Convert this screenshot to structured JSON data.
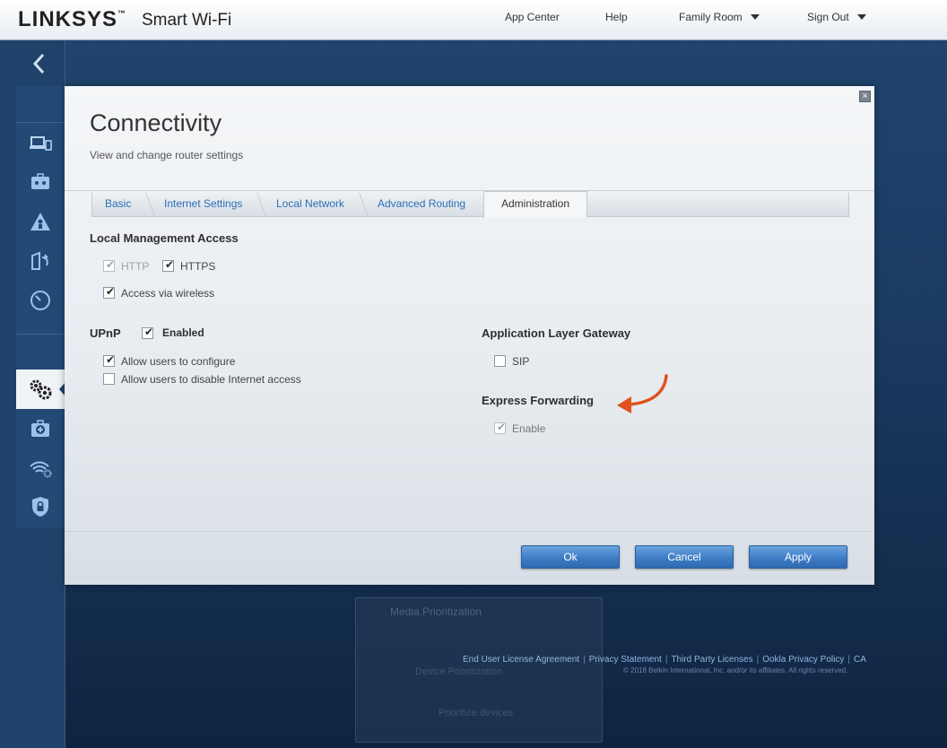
{
  "header": {
    "brand": "LINKSYS",
    "brand_tm": "™",
    "product": "Smart Wi-Fi",
    "nav": {
      "app_center": "App Center",
      "help": "Help",
      "network_name": "Family Room",
      "sign_out": "Sign Out"
    }
  },
  "sidebar": {
    "icons": [
      "devices-icon",
      "parental-controls-icon",
      "guest-access-icon",
      "media-prioritization-icon",
      "speed-test-icon",
      "connectivity-gear-icon",
      "troubleshooting-icon",
      "wireless-icon",
      "security-icon"
    ],
    "active": "connectivity-gear-icon"
  },
  "dialog": {
    "title": "Connectivity",
    "subtitle": "View and change router settings",
    "tabs": [
      "Basic",
      "Internet Settings",
      "Local Network",
      "Advanced Routing",
      "Administration"
    ],
    "active_tab": "Administration",
    "local_management": {
      "heading": "Local Management Access",
      "http_label": "HTTP",
      "http_checked": true,
      "http_disabled": true,
      "https_label": "HTTPS",
      "https_checked": true,
      "wireless_label": "Access via wireless",
      "wireless_checked": true
    },
    "upnp": {
      "heading": "UPnP",
      "enabled_label": "Enabled",
      "enabled_checked": true,
      "allow_configure_label": "Allow users to configure",
      "allow_configure_checked": true,
      "allow_disable_label": "Allow users to disable Internet access",
      "allow_disable_checked": false
    },
    "alg": {
      "heading": "Application Layer Gateway",
      "sip_label": "SIP",
      "sip_checked": false
    },
    "express_forwarding": {
      "heading": "Express Forwarding",
      "enable_label": "Enable",
      "enable_checked": true,
      "enable_disabled": true,
      "annotation_arrow_color": "#e0511d"
    },
    "buttons": {
      "ok": "Ok",
      "cancel": "Cancel",
      "apply": "Apply"
    }
  },
  "background_dialog": {
    "title": "Media Prioritization",
    "line1": "Device Prioritization",
    "line2": "Prioritize devices"
  },
  "footer": {
    "links": [
      "End User License Agreement",
      "Privacy Statement",
      "Third Party Licenses",
      "Ookla Privacy Policy",
      "CA"
    ],
    "copyright": "© 2018 Belkin International, Inc. and/or its affiliates. All rights reserved."
  },
  "colors": {
    "accent": "#2b6fb7",
    "page_bg": "#1f426a",
    "arrow": "#e0511d"
  }
}
